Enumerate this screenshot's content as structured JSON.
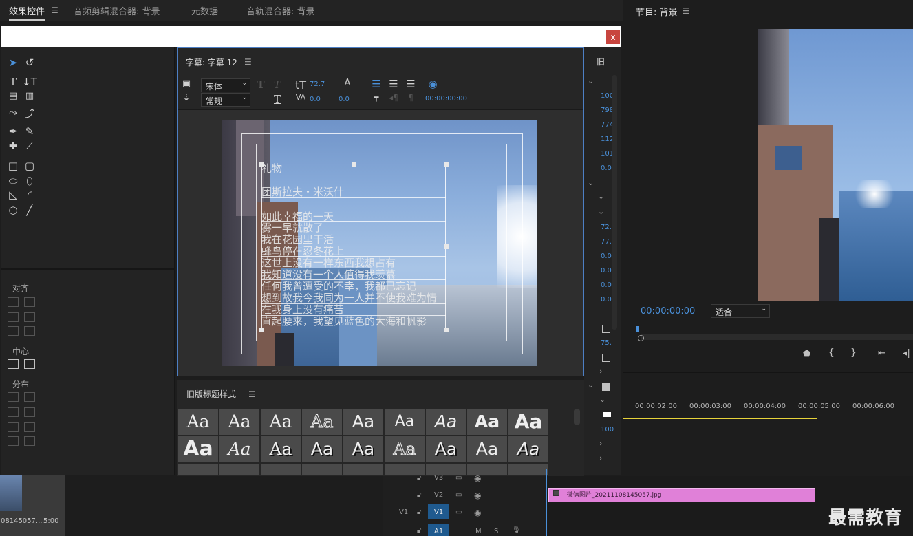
{
  "top_tabs": [
    {
      "label": "效果控件",
      "active": true
    },
    {
      "label": "音频剪辑混合器: 背景",
      "active": false
    },
    {
      "label": "元数据",
      "active": false
    },
    {
      "label": "音轨混合器: 背景",
      "active": false
    }
  ],
  "close_label": "x",
  "titler": {
    "header": "字幕: 字幕 12",
    "font_family": "宋体",
    "font_style": "常规",
    "font_size": "72.7",
    "kerning": "0.0",
    "leading": "0.0",
    "timecode": "00:00:00:00",
    "text_lines": [
      "礼物",
      "团斯拉夫・米沃什",
      "如此幸福的一天",
      "雾一早就散了",
      "我在花园里干活",
      "蜂鸟停在忍冬花上",
      "这世上没有一样东西我想占有",
      "我知道没有一个人值得我羡慕",
      "任何我曾遭受的不幸，我都已忘记",
      "想到故我今我同为一人并不使我难为情",
      "在我身上没有痛苦",
      "直起腰来，我望见蓝色的大海和帆影"
    ]
  },
  "align_panel": {
    "align_label": "对齐",
    "center_label": "中心",
    "distribute_label": "分布"
  },
  "styles_panel": {
    "header": "旧版标题样式",
    "swatch_text": "Aa"
  },
  "props_panel": {
    "header": "旧",
    "values": [
      "100",
      "798",
      "774",
      "112",
      "101",
      "0.0",
      "72.",
      "77.",
      "0.0",
      "0.0",
      "0.0",
      "0.0",
      "75.",
      "100"
    ]
  },
  "program": {
    "header": "节目: 背景",
    "timecode": "00:00:00:00",
    "fit": "适合"
  },
  "timeline": {
    "ruler": [
      "00:00:02:00",
      "00:00:03:00",
      "00:00:04:00",
      "00:00:05:00",
      "00:00:06:00"
    ],
    "tracks": [
      "V3",
      "V2",
      "V1",
      "A1"
    ],
    "track_labels": {
      "v1_source": "V1",
      "mute": "M",
      "solo": "S"
    },
    "clip_name": "微信图片_20211108145057.jpg"
  },
  "bin": {
    "file_label": "08145057...",
    "duration": "5:00"
  },
  "watermark": "最需教育",
  "colors": {
    "accent": "#4a90d9",
    "clip": "#e080d8",
    "playhead_line": "#e6d23a"
  }
}
